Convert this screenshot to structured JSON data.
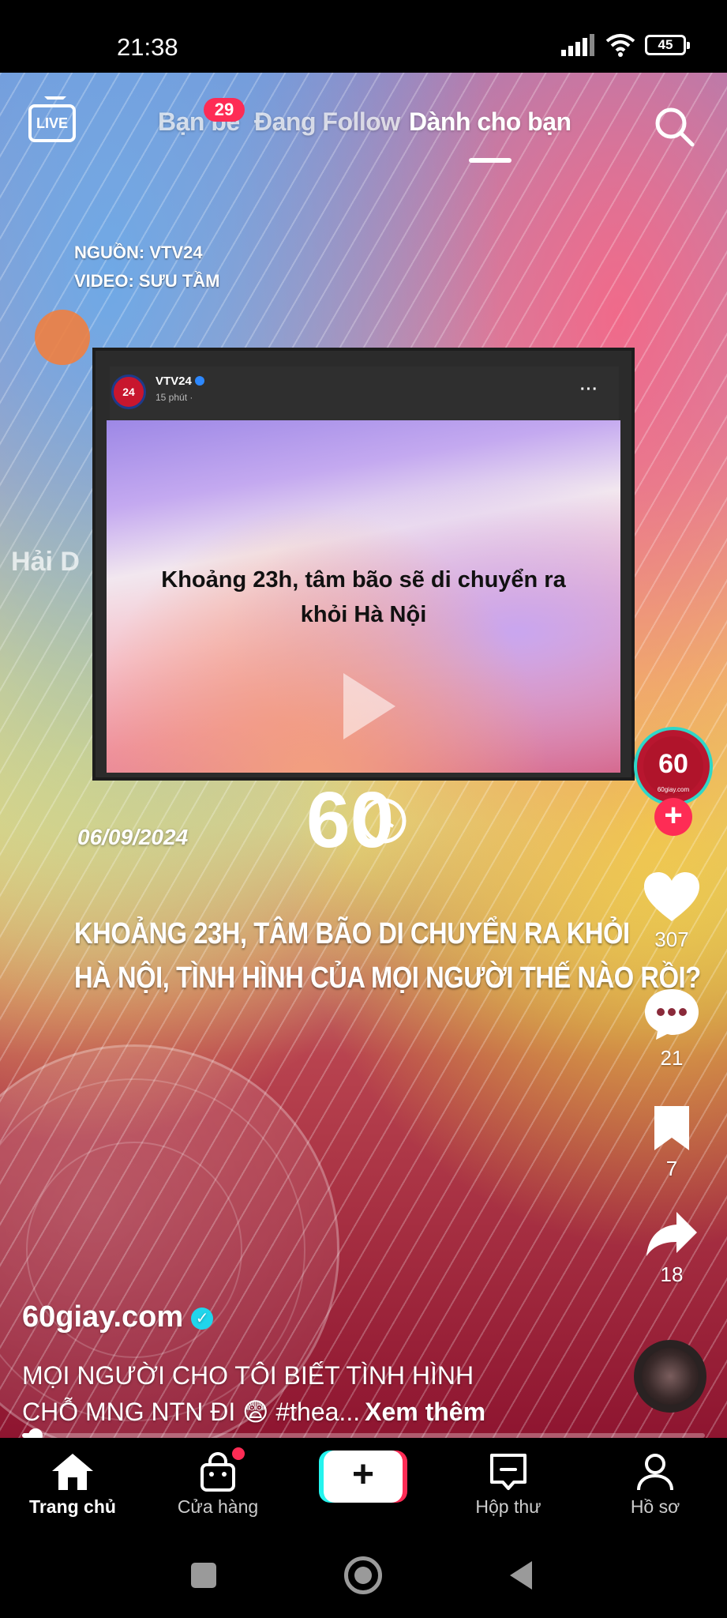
{
  "status_bar": {
    "time": "21:38",
    "battery": "45"
  },
  "top_nav": {
    "live_label": "LIVE",
    "tabs": [
      {
        "label": "Bạn bè",
        "badge": "29"
      },
      {
        "label": "Đang Follow"
      },
      {
        "label": "Dành cho bạn",
        "active": true
      }
    ]
  },
  "video": {
    "source_line1": "NGUỒN: VTV24",
    "source_line2": "VIDEO: SƯU TẦM",
    "place_label": "Hải D",
    "embedded_post": {
      "page_name": "VTV24",
      "avatar_text": "24",
      "time": "15 phút ·",
      "more": "···",
      "text_line1": "Khoảng 23h, tâm bão sẽ di chuyển ra",
      "text_line2": "khỏi Hà Nội"
    },
    "logo_text": "60",
    "date": "06/09/2024",
    "headline_line1": "KHOẢNG 23H, TÂM BÃO DI CHUYỂN RA KHỎI",
    "headline_line2": "HÀ NỘI, TÌNH HÌNH CỦA MỌI NGƯỜI THẾ NÀO RỒI?"
  },
  "actions": {
    "creator_avatar_text": "60",
    "creator_avatar_sub": "60giay.com",
    "likes": "307",
    "comments": "21",
    "saves": "7",
    "shares": "18"
  },
  "post": {
    "creator": "60giay.com",
    "caption_line1": "MỌI NGƯỜI CHO TÔI BIẾT TÌNH HÌNH",
    "caption_line2": "CHỖ MNG NTN ĐI 😨 #thea...",
    "see_more": "Xem thêm",
    "progress": 0.02
  },
  "bottom_nav": {
    "home": "Trang chủ",
    "shop": "Cửa hàng",
    "create": "+",
    "inbox": "Hộp thư",
    "profile": "Hồ sơ"
  },
  "colors": {
    "accent": "#fe2c55",
    "cyan": "#25f4ee",
    "verified": "#20d5ec"
  }
}
